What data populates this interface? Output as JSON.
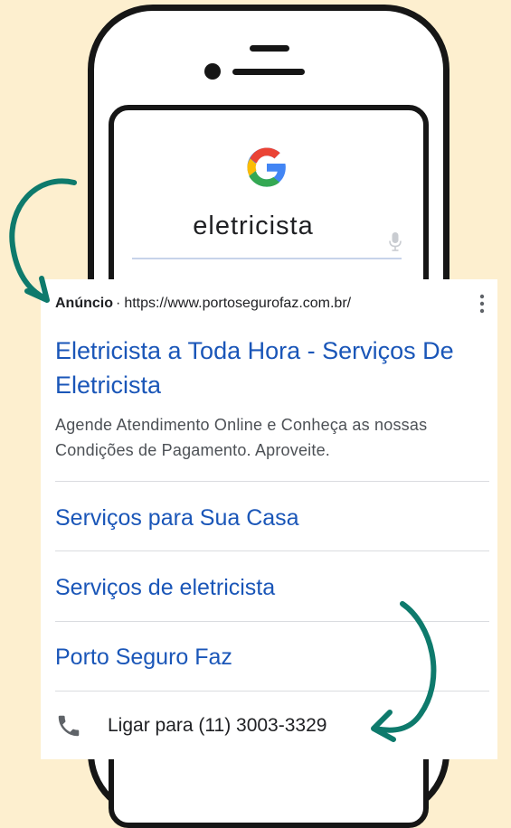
{
  "search": {
    "query": "eletricista"
  },
  "ad": {
    "label": "Anúncio",
    "separator": "·",
    "url": "https://www.portosegurofaz.com.br/",
    "title": "Eletricista a Toda Hora - Serviços De Eletricista",
    "description": "Agende Atendimento Online e Conheça as nossas Condições de Pagamento. Aproveite.",
    "sitelinks": [
      {
        "label": "Serviços para Sua Casa"
      },
      {
        "label": "Serviços de eletricista"
      },
      {
        "label": "Porto Seguro Faz"
      }
    ],
    "call": {
      "label": "Ligar para (11) 3003-3329"
    }
  },
  "colors": {
    "background": "#fdefcf",
    "link": "#1a56b8",
    "arrow": "#0e7a6c"
  },
  "icons": [
    "google-logo",
    "mic-icon",
    "more-vert-icon",
    "phone-icon",
    "curved-arrow-icon"
  ]
}
